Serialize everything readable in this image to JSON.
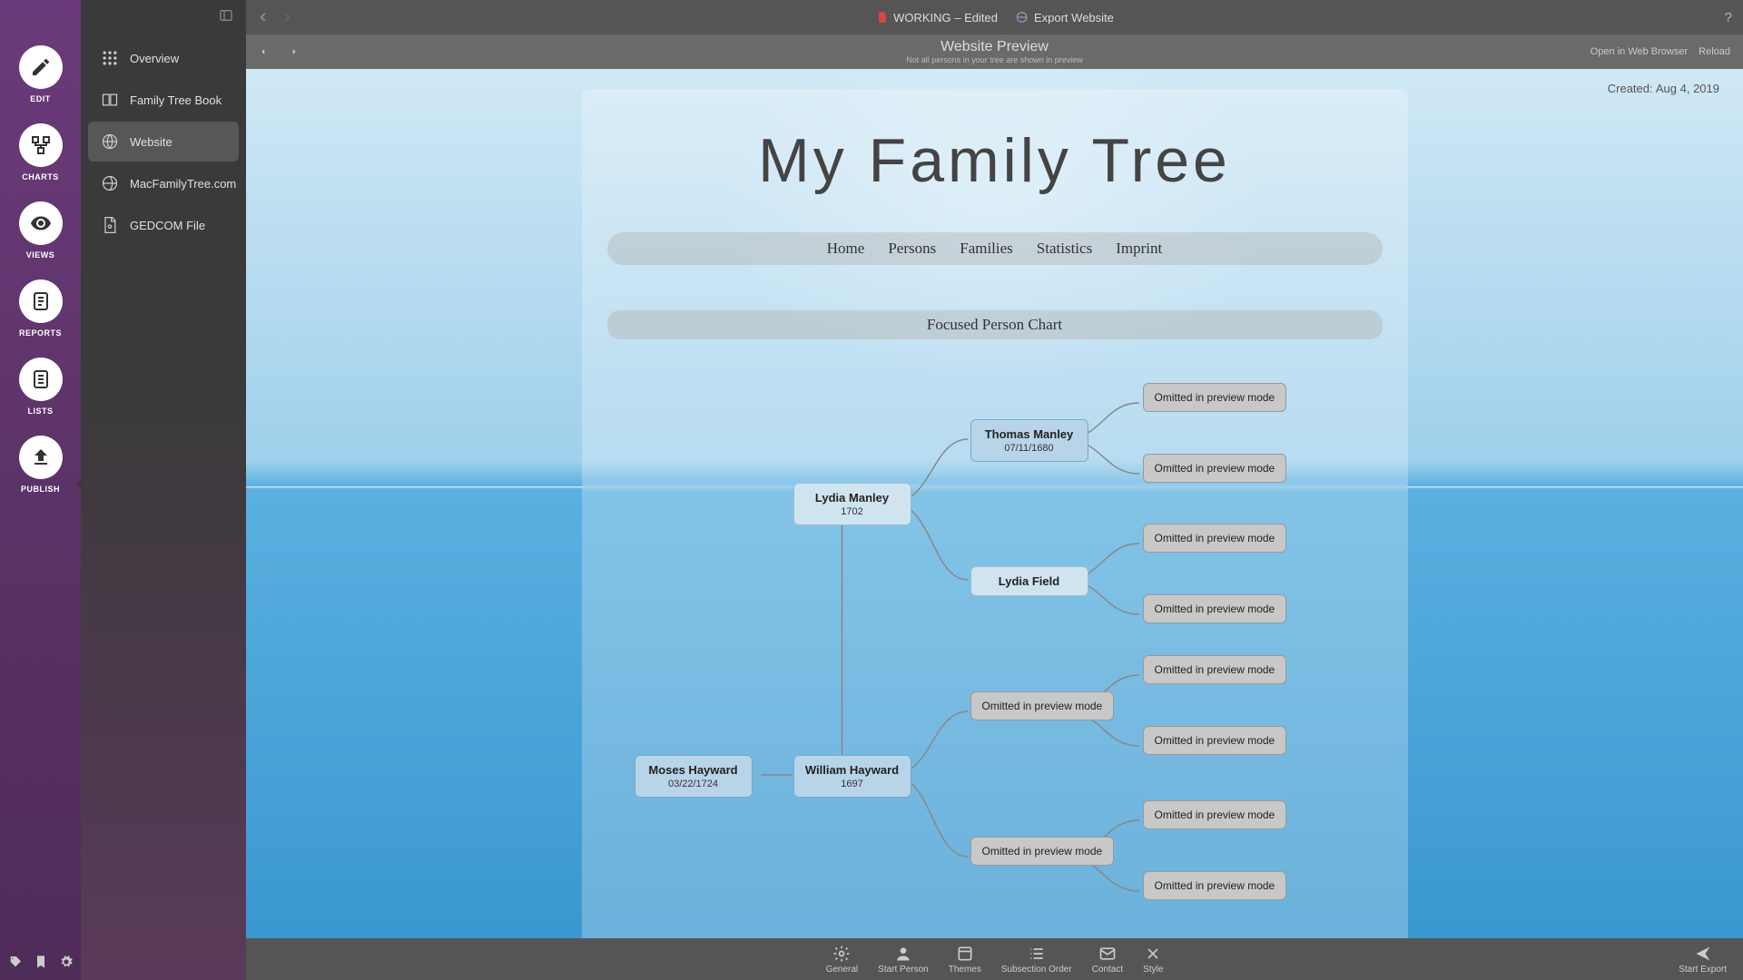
{
  "rail": {
    "items": [
      {
        "label": "EDIT"
      },
      {
        "label": "CHARTS"
      },
      {
        "label": "VIEWS"
      },
      {
        "label": "REPORTS"
      },
      {
        "label": "LISTS"
      },
      {
        "label": "PUBLISH"
      }
    ]
  },
  "sidebar": {
    "items": [
      {
        "label": "Overview"
      },
      {
        "label": "Family Tree Book"
      },
      {
        "label": "Website"
      },
      {
        "label": "MacFamilyTree.com"
      },
      {
        "label": "GEDCOM File"
      }
    ]
  },
  "titlebar": {
    "doc": "WORKING – Edited",
    "export": "Export Website",
    "help": "?"
  },
  "subbar": {
    "title": "Website Preview",
    "subtitle": "Not all persons in your tree are shown in preview",
    "open": "Open in Web Browser",
    "reload": "Reload"
  },
  "preview": {
    "created_label": "Created:",
    "created_date": "Aug 4, 2019",
    "site_title": "My Family Tree",
    "nav": [
      "Home",
      "Persons",
      "Families",
      "Statistics",
      "Imprint"
    ],
    "section": "Focused Person Chart"
  },
  "chart": {
    "omitted": "Omitted in preview mode",
    "nodes": {
      "moses": {
        "name": "Moses Hayward",
        "date": "03/22/1724"
      },
      "lydia_m": {
        "name": "Lydia Manley",
        "date": "1702"
      },
      "william": {
        "name": "William Hayward",
        "date": "1697"
      },
      "thomas": {
        "name": "Thomas Manley",
        "date": "07/11/1680"
      },
      "lydia_f": {
        "name": "Lydia Field",
        "date": ""
      }
    }
  },
  "bottombar": {
    "items": [
      "General",
      "Start Person",
      "Themes",
      "Subsection Order",
      "Contact",
      "Style"
    ],
    "export": "Start Export"
  }
}
